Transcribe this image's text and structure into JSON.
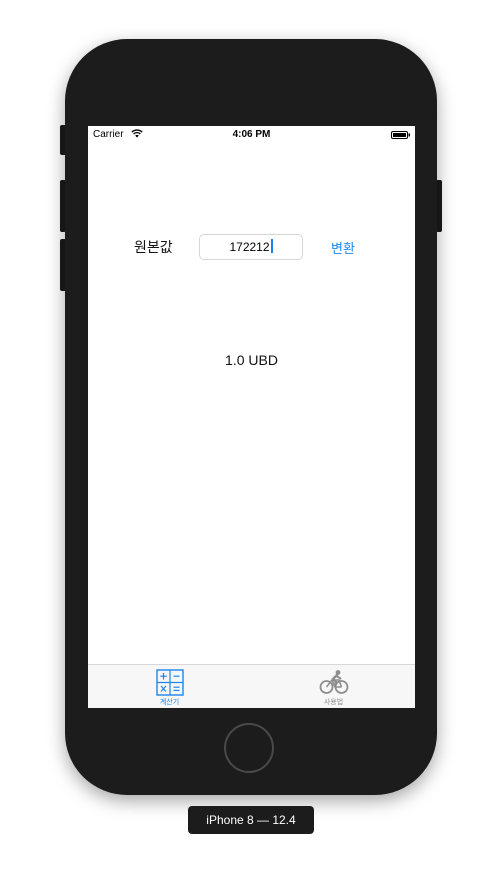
{
  "status_bar": {
    "carrier": "Carrier",
    "time": "4:06 PM",
    "wifi_icon": "wifi-icon",
    "battery_icon": "battery-icon"
  },
  "converter": {
    "label": "원본값",
    "input_value": "172212",
    "convert_button": "변환",
    "result": "1.0 UBD"
  },
  "tab_bar": {
    "tabs": [
      {
        "label": "계산기",
        "icon": "calculator-icon",
        "selected": true
      },
      {
        "label": "사용법",
        "icon": "bicycle-icon",
        "selected": false
      }
    ]
  },
  "simulator": {
    "device_label": "iPhone 8 — 12.4"
  },
  "colors": {
    "accent": "#1a86f0",
    "inactive": "#8e8e8e",
    "device": "#1c1c1c"
  }
}
